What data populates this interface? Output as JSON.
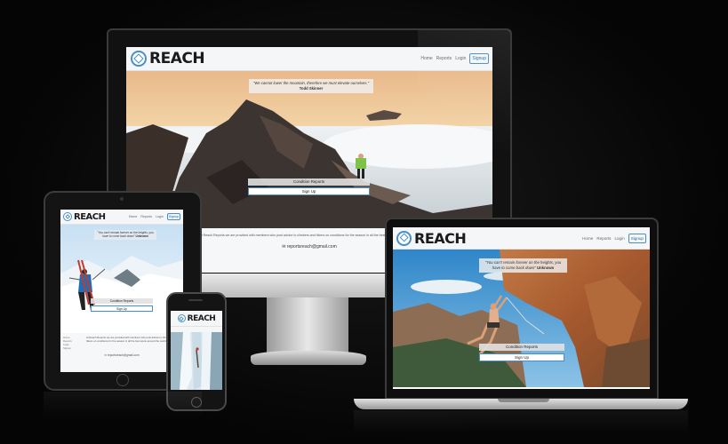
{
  "site": {
    "brand": "REACH",
    "nav": {
      "home": "Home",
      "reports": "Reports",
      "login": "Login",
      "signup": "Signup"
    },
    "buttons": {
      "condition": "Condition Reports",
      "signup": "Sign Up"
    },
    "email": "reportsreach@gmail.com"
  },
  "desktop": {
    "quote": "\"We cannot lower the mountain, therefore we must elevate ourselves.\"",
    "author": "Todd Skinner",
    "footer_text": "At Reach Reports we are provided with members who post advice to climbers and hikers on conditions for the season in all the best spots around the world."
  },
  "laptop": {
    "quote": "\"You can't remain forever on the heights, you have to come back down\"",
    "author": "Unknown"
  },
  "tablet": {
    "quote": "\"You can't remain forever on the heights, you have to come back down\"",
    "author": "Unknown"
  }
}
